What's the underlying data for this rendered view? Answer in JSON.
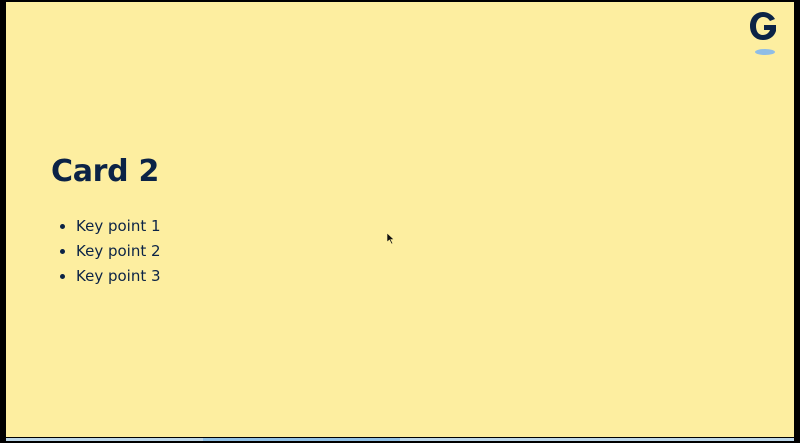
{
  "slide": {
    "title": "Card 2",
    "bullets": [
      "Key point 1",
      "Key point 2",
      "Key point 3"
    ]
  },
  "logo": {
    "letter": "G",
    "icon": "brand-g-logo-icon",
    "color": "#0b2346",
    "accent": "#8fbde6"
  },
  "colors": {
    "background": "#fdeea0",
    "text": "#0b2346",
    "progress": "#8fbfe4"
  },
  "progress": {
    "segment_start_fraction": 0.25,
    "segment_end_fraction": 0.5
  }
}
